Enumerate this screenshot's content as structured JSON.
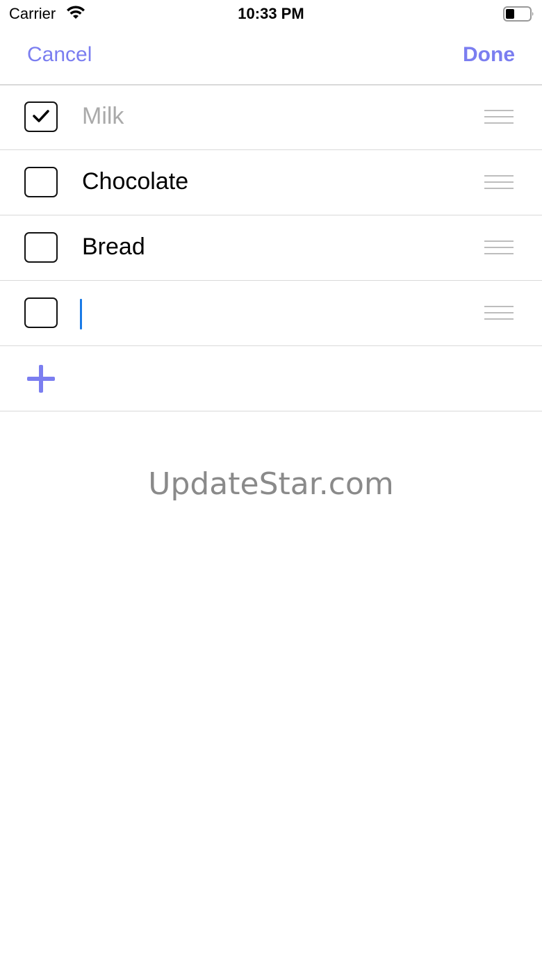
{
  "status_bar": {
    "carrier": "Carrier",
    "time": "10:33 PM",
    "wifi_icon": "wifi-icon",
    "battery_icon": "battery-icon"
  },
  "nav": {
    "cancel_label": "Cancel",
    "done_label": "Done",
    "accent_color": "#7b7ef0"
  },
  "items": [
    {
      "label": "Milk",
      "checked": true
    },
    {
      "label": "Chocolate",
      "checked": false
    },
    {
      "label": "Bread",
      "checked": false
    },
    {
      "label": "",
      "checked": false,
      "editing": true
    }
  ],
  "add_button_icon": "plus-icon",
  "watermark": "UpdateStar.com"
}
